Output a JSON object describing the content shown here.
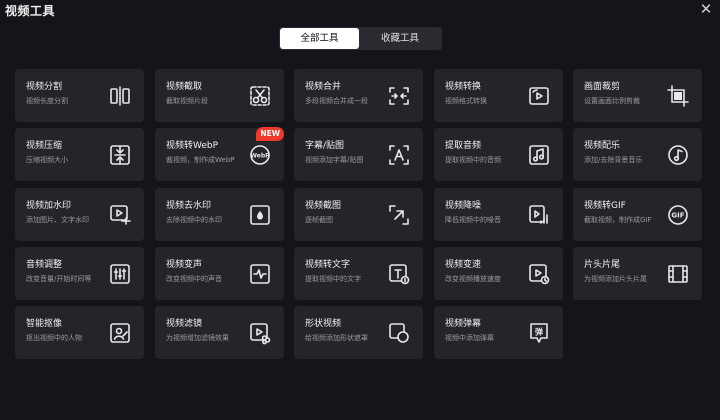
{
  "window": {
    "title": "视频工具",
    "close_glyph": "✕"
  },
  "tabs": [
    {
      "label": "全部工具",
      "active": true
    },
    {
      "label": "收藏工具",
      "active": false
    }
  ],
  "tools": [
    {
      "name": "视频分割",
      "desc": "视频长度分割",
      "icon": "split-icon"
    },
    {
      "name": "视频截取",
      "desc": "截取视频片段",
      "icon": "cut-icon"
    },
    {
      "name": "视频合并",
      "desc": "多段视频合并成一段",
      "icon": "merge-icon"
    },
    {
      "name": "视频转换",
      "desc": "视频格式转换",
      "icon": "convert-icon"
    },
    {
      "name": "画面裁剪",
      "desc": "设置画面比例剪裁",
      "icon": "crop-icon"
    },
    {
      "name": "视频压缩",
      "desc": "压缩视频大小",
      "icon": "compress-icon"
    },
    {
      "name": "视频转WebP",
      "desc": "裁视频，制作成WebP",
      "icon": "webp-icon",
      "badge": "NEW"
    },
    {
      "name": "字幕/贴图",
      "desc": "视频添加字幕/贴图",
      "icon": "subtitle-icon"
    },
    {
      "name": "提取音频",
      "desc": "提取视频中的音频",
      "icon": "audio-extract-icon"
    },
    {
      "name": "视频配乐",
      "desc": "添加/去除背景音乐",
      "icon": "music-icon"
    },
    {
      "name": "视频加水印",
      "desc": "添加图片、文字水印",
      "icon": "add-watermark-icon"
    },
    {
      "name": "视频去水印",
      "desc": "去除视频中的水印",
      "icon": "remove-watermark-icon"
    },
    {
      "name": "视频截图",
      "desc": "逐帧截图",
      "icon": "screenshot-icon"
    },
    {
      "name": "视频降噪",
      "desc": "降低视频中的噪音",
      "icon": "denoise-icon"
    },
    {
      "name": "视频转GIF",
      "desc": "截取视频，制作成GIF",
      "icon": "gif-icon"
    },
    {
      "name": "音频调整",
      "desc": "改变音量/开始时间等",
      "icon": "audio-adjust-icon"
    },
    {
      "name": "视频变声",
      "desc": "改变视频中的声音",
      "icon": "voice-change-icon"
    },
    {
      "name": "视频转文字",
      "desc": "提取视频中的文字",
      "icon": "speech-to-text-icon"
    },
    {
      "name": "视频变速",
      "desc": "改变视频播放速度",
      "icon": "speed-icon"
    },
    {
      "name": "片头片尾",
      "desc": "为视频添加片头片尾",
      "icon": "intro-outro-icon"
    },
    {
      "name": "智能抠像",
      "desc": "抠出视频中的人物",
      "icon": "matting-icon"
    },
    {
      "name": "视频滤镜",
      "desc": "为视频增加滤镜效果",
      "icon": "filter-icon"
    },
    {
      "name": "形状视频",
      "desc": "给视频添加形状遮罩",
      "icon": "shape-icon"
    },
    {
      "name": "视频弹幕",
      "desc": "视频中添加弹幕",
      "icon": "danmaku-icon"
    }
  ],
  "colors": {
    "background": "#141518",
    "card": "#23252a",
    "badge": "#f0392b",
    "icon": "#e8e8e8"
  }
}
